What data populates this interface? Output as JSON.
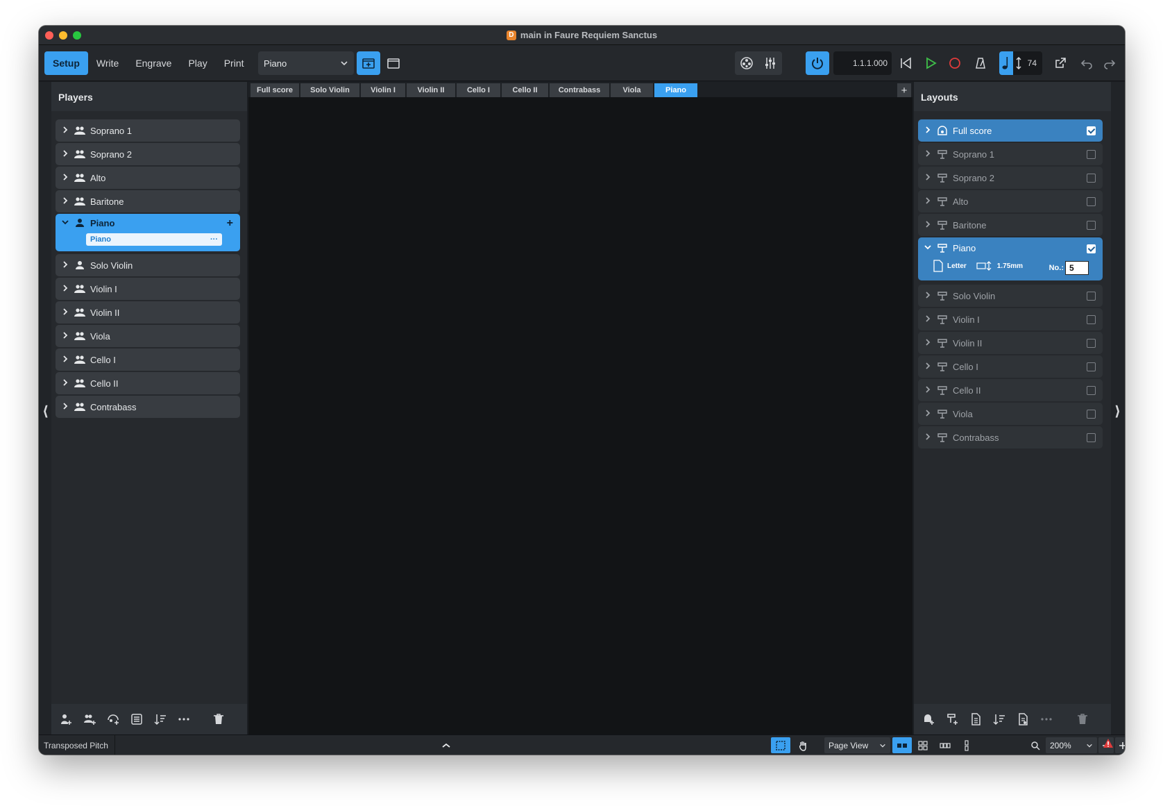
{
  "window": {
    "title": "main in Faure Requiem Sanctus"
  },
  "toolbar": {
    "modes": [
      "Setup",
      "Write",
      "Engrave",
      "Play",
      "Print"
    ],
    "active_mode": "Setup",
    "layout_select": "Piano",
    "counter": "1.1.1.000",
    "tempo": "74"
  },
  "players_panel": {
    "title": "Players",
    "players": [
      {
        "label": "Soprano 1",
        "type": "section"
      },
      {
        "label": "Soprano 2",
        "type": "section"
      },
      {
        "label": "Alto",
        "type": "section"
      },
      {
        "label": "Baritone",
        "type": "section"
      },
      {
        "label": "Piano",
        "type": "solo",
        "selected": true,
        "instrument": "Piano"
      },
      {
        "label": "Solo Violin",
        "type": "solo"
      },
      {
        "label": "Violin I",
        "type": "section"
      },
      {
        "label": "Violin II",
        "type": "section"
      },
      {
        "label": "Viola",
        "type": "section"
      },
      {
        "label": "Cello I",
        "type": "section"
      },
      {
        "label": "Cello II",
        "type": "section"
      },
      {
        "label": "Contrabass",
        "type": "section"
      }
    ]
  },
  "tabs": [
    "Full score",
    "Solo Violin",
    "Violin I",
    "Violin II",
    "Cello I",
    "Cello II",
    "Contrabass",
    "Viola",
    "Piano"
  ],
  "active_tab": "Piano",
  "layouts_panel": {
    "title": "Layouts",
    "layouts": [
      {
        "label": "Full score",
        "selected": true,
        "checked": true
      },
      {
        "label": "Soprano 1"
      },
      {
        "label": "Soprano 2"
      },
      {
        "label": "Alto"
      },
      {
        "label": "Baritone"
      },
      {
        "label": "Piano",
        "selected": true,
        "checked": true,
        "expanded": true
      },
      {
        "label": "Solo Violin"
      },
      {
        "label": "Violin I"
      },
      {
        "label": "Violin II"
      },
      {
        "label": "Cello I"
      },
      {
        "label": "Cello II"
      },
      {
        "label": "Viola"
      },
      {
        "label": "Contrabass"
      }
    ],
    "piano_details": {
      "page_size": "Letter",
      "staff_size": "1.75mm",
      "no_label": "No.:",
      "no_value": "5"
    }
  },
  "statusbar": {
    "pitch_mode": "Transposed Pitch",
    "view_mode": "Page View",
    "zoom": "200%"
  },
  "colors": {
    "accent": "#3aa0f0",
    "record": "#e03b3b",
    "play": "#3fbf4a",
    "warning": "#e03b3b"
  }
}
